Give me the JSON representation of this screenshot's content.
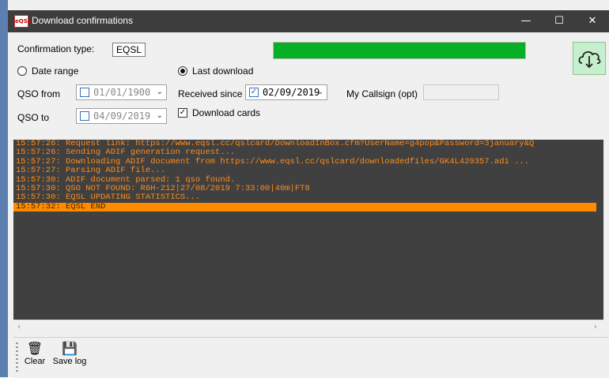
{
  "window": {
    "title": "Download confirmations",
    "app_icon": "eqsl-app-icon",
    "controls": [
      "minimize",
      "maximize",
      "close"
    ]
  },
  "form": {
    "confirmation_type_label": "Confirmation type:",
    "confirmation_type_value": "EQSL",
    "progress_color": "#06b025",
    "date_range_label": "Date range",
    "last_download_label": "Last download",
    "selected_mode": "Last download",
    "qso_from_label": "QSO from",
    "qso_from_value": "01/01/1900",
    "qso_to_label": "QSO to",
    "qso_to_value": "04/09/2019",
    "received_since_label": "Received since",
    "received_since_value": "02/09/2019",
    "callsign_label": "My Callsign (opt)",
    "callsign_value": "",
    "download_cards_label": "Download cards",
    "download_cards_checked": true,
    "download_button_icon": "cloud-download-icon"
  },
  "log": {
    "lines": [
      "15:57:26: Request link: https://www.eqsl.cc/qslcard/DownloadInBox.cfm?UserName=g4pop&Password=3january&Q",
      "15:57:26: Sending ADIF generation request...",
      "15:57:27: Downloading ADIF document from https://www.eqsl.cc/qslcard/downloadedfiles/GK4L429357.adi ...",
      "15:57:27: Parsing ADIF file...",
      "15:57:30: ADIF document parsed: 1 qso found.",
      "15:57:30: QSO NOT FOUND: R6H-212|27/08/2019 7:33:00|40m|FT8",
      "15:57:30: EQSL UPDATING STATISTICS...",
      "15:57:32: EQSL END"
    ],
    "highlighted_index": 7,
    "text_color": "#ff8c1a",
    "highlight_color": "#ff8c00",
    "background": "#404040"
  },
  "toolbar": {
    "clear_label": "Clear",
    "clear_icon": "trash-icon",
    "save_label": "Save log",
    "save_icon": "save-icon"
  }
}
